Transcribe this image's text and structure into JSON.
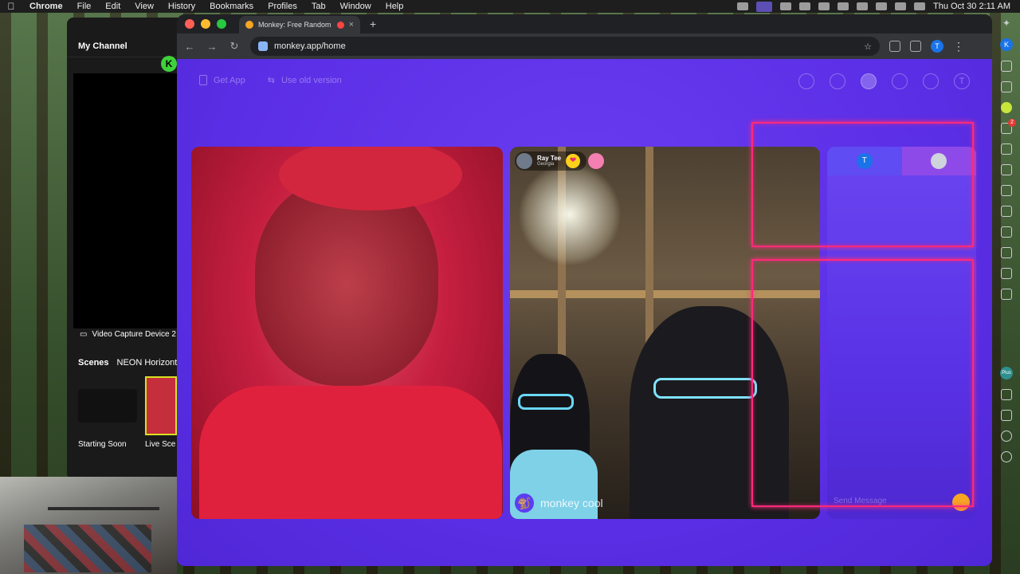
{
  "menubar": {
    "app": "Chrome",
    "items": [
      "File",
      "Edit",
      "View",
      "History",
      "Bookmarks",
      "Profiles",
      "Tab",
      "Window",
      "Help"
    ],
    "clock": "Thu Oct 30  2:11 AM"
  },
  "obs": {
    "channel": "My Channel",
    "device": "Video Capture Device 2",
    "scenes_label": "Scenes",
    "scene_collection": "NEON Horizontal",
    "scene1": "Starting Soon",
    "scene2": "Live Sce"
  },
  "browser": {
    "tab_title": "Monkey: Free Random Vid",
    "url": "monkey.app/home",
    "profile_initial": "T"
  },
  "page": {
    "get_app": "Get App",
    "use_old_version": "Use old version",
    "user_initial": "T",
    "remote_user": {
      "name": "Ray Tee",
      "location": "Georgia"
    },
    "watermark": "monkey cool",
    "chat_tab_initial": "T",
    "chat_placeholder": "Send Message"
  },
  "dock": {
    "profile_initial": "K",
    "notification_count": "2",
    "plus": "Plus"
  }
}
